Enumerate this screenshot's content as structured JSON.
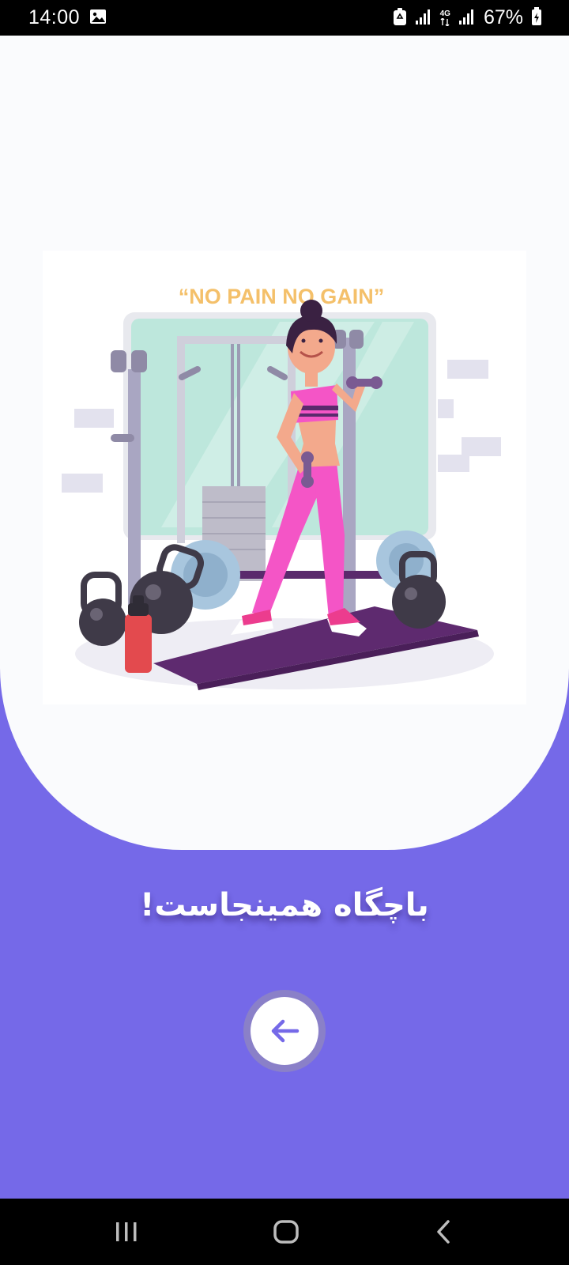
{
  "status_bar": {
    "time": "14:00",
    "network": "4G",
    "battery": "67%",
    "icons": [
      "gallery-icon",
      "recycle-icon",
      "signal-icon",
      "battery-icon"
    ]
  },
  "illustration": {
    "poster_text": "“NO PAIN NO GAIN”"
  },
  "onboarding": {
    "title": "باچگاه همینجاست!",
    "next_icon": "arrow-left-icon"
  },
  "nav_bar": {
    "recents_icon": "recents-icon",
    "home_icon": "home-icon",
    "back_icon": "back-icon"
  },
  "colors": {
    "background": "#7569E8",
    "card": "#FAFBFD",
    "button_ring": "#8A80C8",
    "arrow": "#7569E8"
  }
}
